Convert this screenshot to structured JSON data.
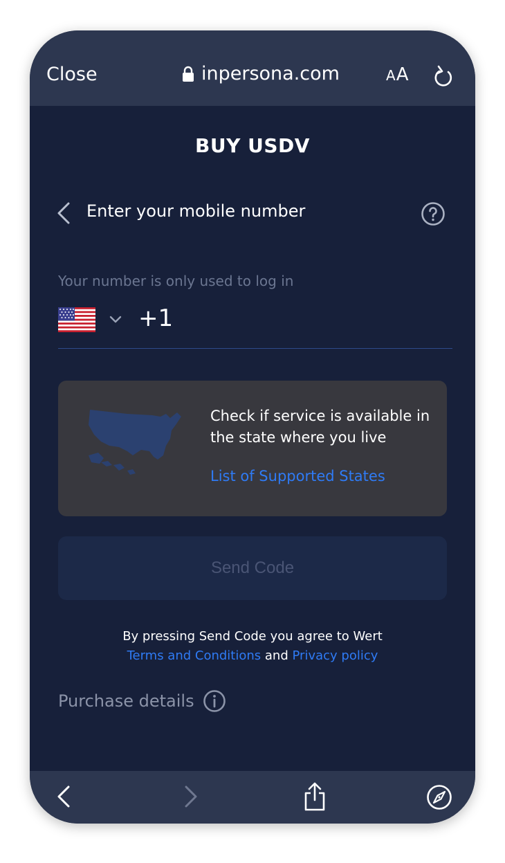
{
  "browser": {
    "close_label": "Close",
    "url": "inpersona.com",
    "text_size_small": "A",
    "text_size_large": "A"
  },
  "header": {
    "brand_title": "BUY USDV",
    "screen_title": "Enter your mobile number"
  },
  "phone_input": {
    "helper_text": "Your number is only used to log in",
    "country": "US",
    "dial_code": "+1"
  },
  "availability_card": {
    "text": "Check if service is available in the state where you live",
    "link_label": "List of Supported States"
  },
  "send_button": {
    "label": "Send Code",
    "enabled": false
  },
  "terms": {
    "prefix": "By pressing Send Code you agree to Wert",
    "terms_link": "Terms and Conditions",
    "conjunction": "and",
    "privacy_link": "Privacy policy"
  },
  "purchase_details": {
    "label": "Purchase details"
  },
  "colors": {
    "background": "#17203a",
    "browser_bar": "#2d3750",
    "card": "#38383e",
    "link": "#2f7bf5",
    "disabled_button": "#1c2948",
    "muted_text": "#6b7691"
  },
  "icons": {
    "lock": "lock-icon",
    "reload": "reload-icon",
    "back": "chevron-left-icon",
    "help": "question-circle-icon",
    "country_dropdown": "chevron-down-icon",
    "flag": "us-flag-icon",
    "map": "usa-map-icon",
    "info": "info-circle-icon",
    "share": "share-icon",
    "compass": "compass-icon"
  }
}
